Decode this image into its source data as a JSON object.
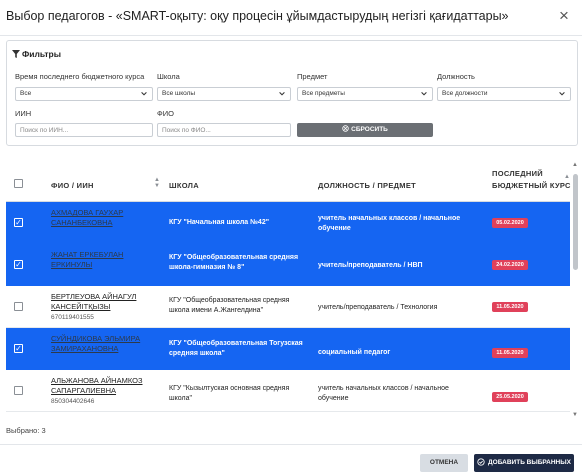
{
  "modal": {
    "title": "Выбор педагогов - «SMART-оқыту: оқу процесін ұйымдастырудың негізгі қағидаттары»"
  },
  "filters": {
    "heading": "Фильтры",
    "course_label": "Время последнего бюджетного курса",
    "course_value": "Все",
    "school_label": "Школа",
    "school_value": "Все школы",
    "subject_label": "Предмет",
    "subject_value": "Все предметы",
    "position_label": "Должность",
    "position_value": "Все должности",
    "iin_label": "ИИН",
    "iin_placeholder": "Поиск по ИИН...",
    "fio_label": "ФИО",
    "fio_placeholder": "Поиск по ФИО...",
    "reset_label": "СБРОСИТЬ"
  },
  "table": {
    "headers": {
      "fio": "ФИО / ИИН",
      "school": "ШКОЛА",
      "position": "ДОЛЖНОСТЬ / ПРЕДМЕТ",
      "last_course_1": "ПОСЛЕДНИЙ",
      "last_course_2": "БЮДЖЕТНЫЙ КУРС"
    },
    "rows": [
      {
        "selected": true,
        "name": "АХМАДОВА ГАУХАР САНАНБЕКОВНА",
        "iin": "",
        "school": "КГУ \"Начальная школа №42\"",
        "position": "учитель начальных классов / начальное обучение",
        "date": "05.02.2020"
      },
      {
        "selected": true,
        "name": "ЖАНАТ ЕРКЕБУЛАН ЕРКИНУЛЫ",
        "iin": "",
        "school": "КГУ \"Общеобразовательная средняя школа-гимназия № 8\"",
        "position": "учитель/преподаватель / НВП",
        "date": "24.02.2020"
      },
      {
        "selected": false,
        "name": "БЕРТЛЕУОВА АЙНАГУЛ КАНСЕЙІТҚЫЗЫ",
        "iin": "670119401555",
        "school": "КГУ \"Общеобразовательная средняя школа имени А.Жангелдина\"",
        "position": "учитель/преподаватель / Технология",
        "date": "11.05.2020"
      },
      {
        "selected": true,
        "name": "СУЙНДИКОВА ЭЛЬМИРА ЗАМИРАХАНОВНА",
        "iin": "",
        "school": "КГУ \"Общеобразовательная Тогузская средняя школа\"",
        "position": "социальный педагог",
        "date": "11.05.2020"
      },
      {
        "selected": false,
        "name": "АЛЬЖАНОВА АЙНАМКОЗ САПАРГАЛИЕВНА",
        "iin": "850304402646",
        "school": "КГУ \"Кызылтуская основная средняя школа\"",
        "position": "учитель начальных классов / начальное обучение",
        "date": "25.05.2020"
      }
    ]
  },
  "footer": {
    "selected_count": "Выбрано: 3",
    "cancel_label": "ОТМЕНА",
    "add_label": "ДОБАВИТЬ ВЫБРАННЫХ"
  },
  "colors": {
    "selected_row": "#1565f2",
    "badge": "#e0415a",
    "primary_button": "#1e2a45"
  }
}
